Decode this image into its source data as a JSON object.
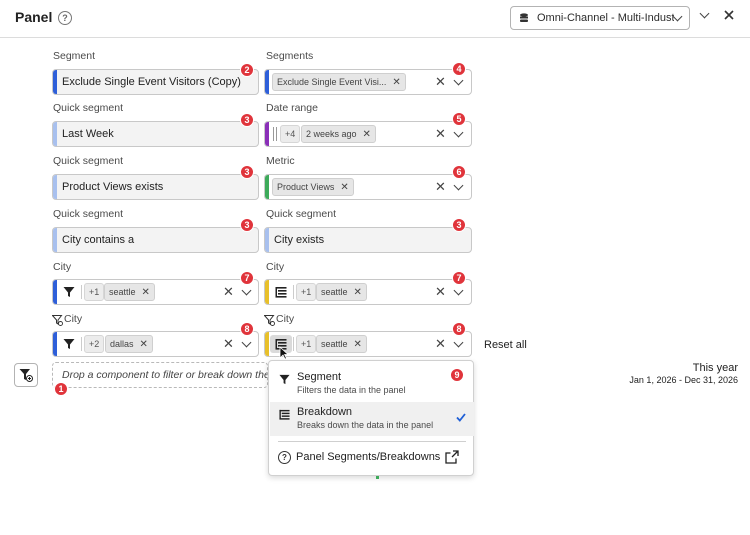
{
  "header": {
    "title": "Panel",
    "help_glyph": "?",
    "report_suite": "Omni-Channel - Multi-Industry"
  },
  "colors": {
    "blue": "#2e5fd9",
    "lightblue": "#a8c0ee",
    "green": "#3daa5a",
    "purple": "#8a2fb8",
    "yellow": "#e8c02a",
    "badge": "#e0343b"
  },
  "fields": {
    "f1": {
      "label": "Segment",
      "value": "Exclude Single Event Visitors (Copy)",
      "badge": "2"
    },
    "f2": {
      "label": "Segments",
      "tag": "Exclude Single Event Visi...",
      "badge": "4"
    },
    "f3": {
      "label": "Quick segment",
      "value": "Last Week",
      "badge": "3"
    },
    "f4": {
      "label": "Date range",
      "plus": "+4",
      "tag": "2 weeks ago",
      "badge": "5"
    },
    "f5": {
      "label": "Quick segment",
      "value": "Product Views exists",
      "badge": "3"
    },
    "f6": {
      "label": "Metric",
      "tag": "Product Views",
      "badge": "6"
    },
    "f7": {
      "label": "Quick segment",
      "value": "City contains a",
      "badge": "3"
    },
    "f8": {
      "label": "Quick segment",
      "value": "City exists",
      "badge": "3"
    },
    "f9": {
      "label": "City",
      "plus": "+1",
      "tag": "seattle",
      "badge": "7",
      "icon": "funnel-icon"
    },
    "f10": {
      "label": "City",
      "plus": "+1",
      "tag": "seattle",
      "badge": "7",
      "icon": "breakdown-icon"
    },
    "f11": {
      "label": "City",
      "plus": "+2",
      "tag": "dallas",
      "badge": "8",
      "icon": "funnel-icon"
    },
    "f12": {
      "label": "City",
      "plus": "+1",
      "tag": "seattle",
      "badge": "8",
      "icon": "breakdown-icon"
    }
  },
  "reset_label": "Reset all",
  "dropzone": {
    "text": "Drop a component to filter or break down the data",
    "badge": "1"
  },
  "menu": {
    "badge": "9",
    "items": [
      {
        "title": "Segment",
        "desc": "Filters the data in the panel",
        "icon": "funnel-icon"
      },
      {
        "title": "Breakdown",
        "desc": "Breaks down the data in the panel",
        "icon": "breakdown-icon",
        "selected": true
      }
    ],
    "footer": {
      "label": "Panel Segments/Breakdowns",
      "icon": "external-link-icon"
    }
  },
  "date_range": {
    "title": "This year",
    "range": "Jan 1, 2026 - Dec 31, 2026"
  }
}
